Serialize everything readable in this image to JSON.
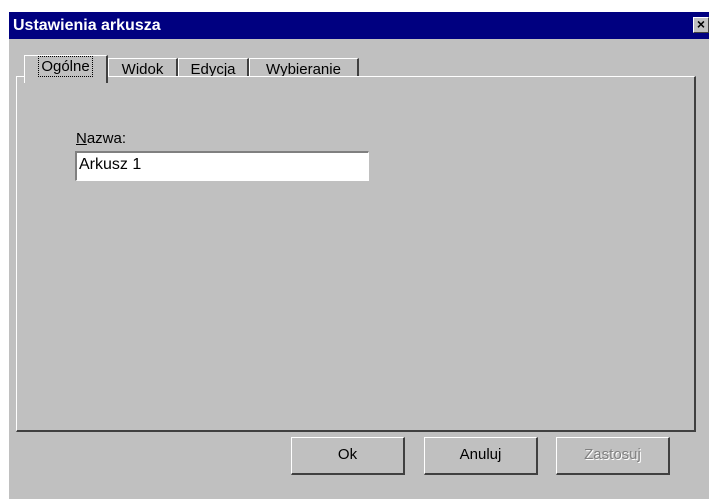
{
  "window": {
    "title": "Ustawienia arkusza",
    "close_glyph": "✕"
  },
  "tabs": [
    {
      "label": "Ogólne",
      "active": true
    },
    {
      "label": "Widok",
      "active": false
    },
    {
      "label": "Edycja",
      "active": false
    },
    {
      "label": "Wybieranie",
      "active": false
    }
  ],
  "general": {
    "name_label_mnemonic": "N",
    "name_label_rest": "azwa:",
    "name_value": "Arkusz 1"
  },
  "buttons": {
    "ok": "Ok",
    "cancel": "Anuluj",
    "apply": "Zastosuj"
  },
  "colors": {
    "title_bar": "#000080",
    "face": "#c0c0c0"
  }
}
